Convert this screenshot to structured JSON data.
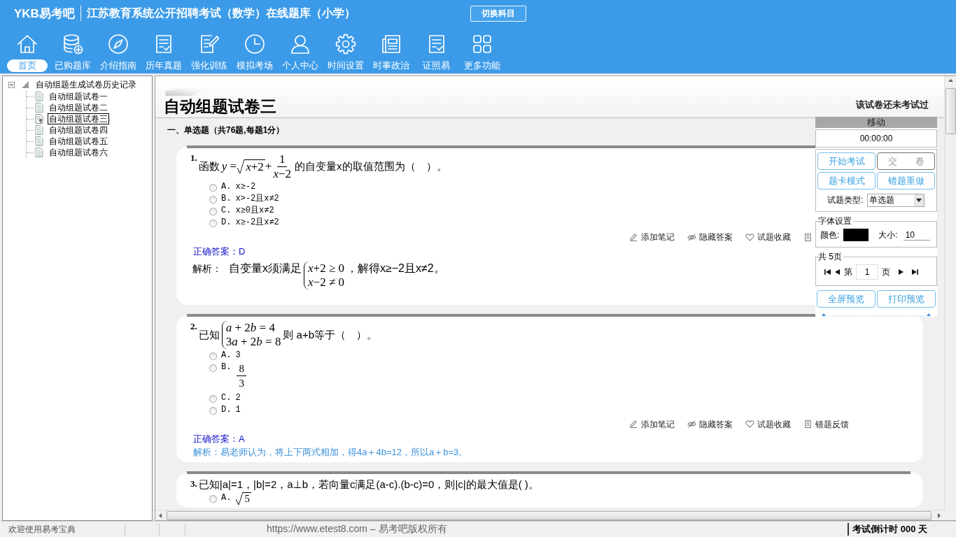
{
  "header": {
    "logo": "YKB易考吧",
    "title": "江苏教育系统公开招聘考试（数学）在线题库（小学）",
    "switch_button": "切换科目"
  },
  "toolbar": [
    {
      "kind": "home",
      "label": "首页",
      "selected": true
    },
    {
      "kind": "database",
      "label": "已购题库",
      "selected": false
    },
    {
      "kind": "compass",
      "label": "介绍指南",
      "selected": false
    },
    {
      "kind": "exam",
      "label": "历年真题",
      "selected": false
    },
    {
      "kind": "edit",
      "label": "强化训练",
      "selected": false
    },
    {
      "kind": "clock",
      "label": "模拟考场",
      "selected": false
    },
    {
      "kind": "user",
      "label": "个人中心",
      "selected": false
    },
    {
      "kind": "gear",
      "label": "时间设置",
      "selected": false
    },
    {
      "kind": "news",
      "label": "时事政治",
      "selected": false
    },
    {
      "kind": "license",
      "label": "证照易",
      "selected": false
    },
    {
      "kind": "grid",
      "label": "更多功能",
      "selected": false
    }
  ],
  "tree": {
    "label": "自动组题生成试卷历史记录",
    "expanded": true,
    "children": [
      {
        "label": "自动组题试卷一",
        "selected": false
      },
      {
        "label": "自动组题试卷二",
        "selected": false
      },
      {
        "label": "自动组题试卷三",
        "selected": true
      },
      {
        "label": "自动组题试卷四",
        "selected": false
      },
      {
        "label": "自动组题试卷五",
        "selected": false
      },
      {
        "label": "自动组题试卷六",
        "selected": false
      }
    ]
  },
  "paper": {
    "title": "自动组题试卷三",
    "status": "该试卷还未考试过",
    "section": "一、单选题（共76题,每题1分）"
  },
  "questions": [
    {
      "number": "1.",
      "stem": [
        {
          "kind": "text",
          "text": "函数"
        },
        {
          "kind": "formula",
          "items": [
            {
              "kind": "plain",
              "text": "y = "
            },
            {
              "kind": "sqrt",
              "text": "x+2"
            },
            {
              "kind": "plain",
              "text": " + "
            },
            {
              "kind": "frac",
              "num": "1",
              "den": "x−2"
            }
          ]
        },
        {
          "kind": "text",
          "text": "的自变量x的取值范围为（　）。"
        }
      ],
      "options": [
        {
          "label": "A.",
          "kind": "text",
          "text": "x≥-2",
          "selected": false
        },
        {
          "label": "B.",
          "kind": "text",
          "text": "x>-2且x≠2",
          "selected": false
        },
        {
          "label": "C.",
          "kind": "text",
          "text": "x≥0且x≠2",
          "selected": false
        },
        {
          "label": "D.",
          "kind": "text",
          "text": "x≥-2且x≠2",
          "selected": false
        }
      ],
      "actions": [
        {
          "kind": "note",
          "label": "添加笔记"
        },
        {
          "kind": "hide",
          "label": "隐藏答案"
        },
        {
          "kind": "favorite",
          "label": "试题收藏"
        },
        {
          "kind": "feedback"
        }
      ],
      "answer": "正确答案：D",
      "analysis": {
        "kind": "formula",
        "label": "解析：",
        "parts": [
          {
            "kind": "text",
            "text": "自变量x须满足"
          },
          {
            "kind": "formula",
            "items": [
              {
                "kind": "system",
                "lines": [
                  "x+2 ≥ 0",
                  "x−2 ≠ 0"
                ]
              }
            ]
          },
          {
            "kind": "text",
            "text": "，解得x≥−2且x≠2。"
          }
        ]
      }
    },
    {
      "number": "2.",
      "stem": [
        {
          "kind": "text",
          "text": "已知"
        },
        {
          "kind": "formula",
          "items": [
            {
              "kind": "system",
              "lines": [
                "a + 2b = 4",
                "3a + 2b = 8"
              ]
            }
          ]
        },
        {
          "kind": "text",
          "text": "则 a+b等于（　）。"
        }
      ],
      "options": [
        {
          "label": "A.",
          "kind": "text",
          "text": "3",
          "selected": false
        },
        {
          "label": "B.",
          "kind": "frac",
          "num": "8",
          "den": "3",
          "selected": false
        },
        {
          "label": "C.",
          "kind": "text",
          "text": "2",
          "selected": false
        },
        {
          "label": "D.",
          "kind": "text",
          "text": "1",
          "selected": false
        }
      ],
      "actions": [
        {
          "kind": "note",
          "label": "添加笔记"
        },
        {
          "kind": "hide",
          "label": "隐藏答案"
        },
        {
          "kind": "favorite",
          "label": "试题收藏"
        },
        {
          "kind": "feedback",
          "label": "错题反馈"
        }
      ],
      "answer": "正确答案：A",
      "analysis": {
        "kind": "text",
        "text": "解析：易老师认为，将上下两式相加，得4a＋4b=12，所以a＋b=3。"
      }
    },
    {
      "number": "3.",
      "stem": [
        {
          "kind": "text",
          "text": "已知|a|=1，|b|=2，a⊥b，若向量c满足(a-c).(b-c)=0，则|c|的最大值是( )。"
        }
      ],
      "options": [
        {
          "label": "A.",
          "kind": "sqrt",
          "text": "5",
          "selected": false
        }
      ]
    }
  ],
  "panel": {
    "handle": "移动",
    "timer": "00:00:00",
    "buttons": [
      {
        "label": "开始考试",
        "disabled": false
      },
      {
        "label": "交　　卷",
        "disabled": true
      },
      {
        "label": "题卡模式",
        "disabled": false
      },
      {
        "label": "错题重做",
        "disabled": false
      }
    ],
    "type_label": "试题类型:",
    "type_value": "单选题",
    "font": {
      "legend": "字体设置",
      "color_label": "颜色:",
      "color": "#000000",
      "size_label": "大小:",
      "size": "10"
    },
    "pager": {
      "legend": "共 5页",
      "prefix": "第",
      "page": "1",
      "suffix": "页"
    },
    "preview_buttons": [
      "全屏预览",
      "打印预览"
    ]
  },
  "status_bar": {
    "welcome": "欢迎使用易考宝典",
    "copyright": "https://www.etest8.com – 易考吧版权所有",
    "countdown": "考试倒计时 000 天"
  }
}
